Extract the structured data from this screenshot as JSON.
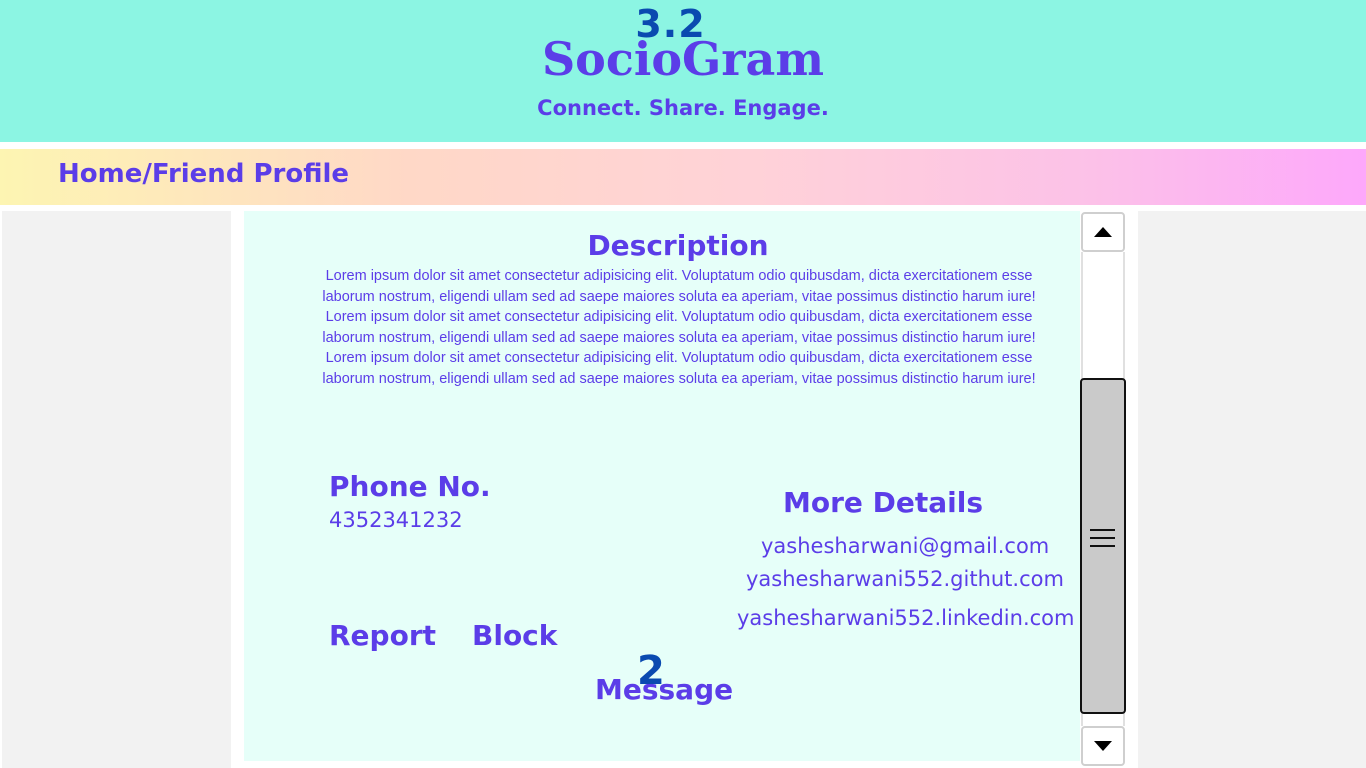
{
  "header": {
    "version": "3.2",
    "brand": "SocioGram",
    "tagline": "Connect. Share. Engage."
  },
  "nav": {
    "breadcrumb": "Home/Friend Profile"
  },
  "profile": {
    "description_title": "Description",
    "description_paragraphs": [
      "Lorem ipsum dolor sit amet consectetur adipisicing elit. Voluptatum odio quibusdam, dicta exercitationem esse laborum nostrum, eligendi ullam sed ad saepe maiores soluta ea aperiam, vitae possimus distinctio harum iure!",
      "Lorem ipsum dolor sit amet consectetur adipisicing elit. Voluptatum odio quibusdam, dicta exercitationem esse laborum nostrum, eligendi ullam sed ad saepe maiores soluta ea aperiam, vitae possimus distinctio harum iure!",
      "Lorem ipsum dolor sit amet consectetur adipisicing elit. Voluptatum odio quibusdam, dicta exercitationem esse laborum nostrum, eligendi ullam sed ad saepe maiores soluta ea aperiam, vitae possimus distinctio harum iure!"
    ],
    "phone_label": "Phone No.",
    "phone_value": "4352341232",
    "more_details_title": "More Details",
    "email": "yashesharwani@gmail.com",
    "github": "yashesharwani552.githut.com",
    "linkedin": "yashesharwani552.linkedin.com",
    "actions": {
      "report": "Report",
      "block": "Block",
      "message": "Message"
    }
  },
  "overlay": {
    "page_number": "2"
  },
  "colors": {
    "header_bg": "#8cf5e3",
    "accent": "#5b3de8",
    "version_color": "#0a4ab0",
    "card_bg": "#e6fff9",
    "side_bg": "#f2f2f2"
  },
  "icons": {
    "scroll_up": "triangle-up-icon",
    "scroll_down": "triangle-down-icon",
    "thumb_grip": "hamburger-grip-icon"
  }
}
